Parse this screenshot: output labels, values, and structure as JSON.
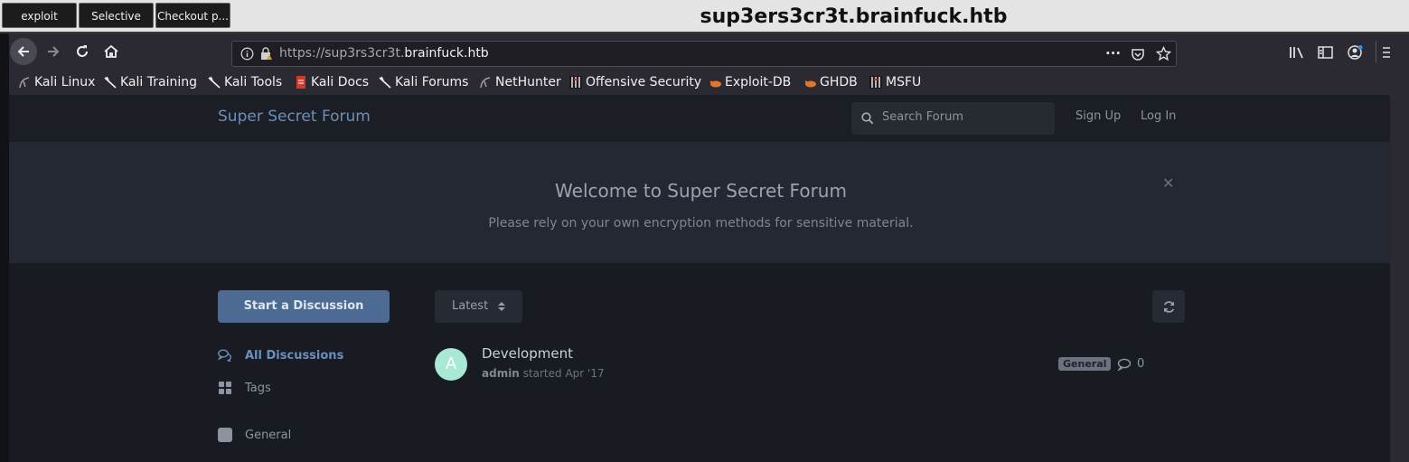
{
  "window": {
    "title": "sup3ers3cr3t.brainfuck.htb",
    "buttons": [
      "exploit",
      "Selective",
      "Checkout p..."
    ]
  },
  "browser": {
    "url_prefix": "https://sup3rs3cr3t.",
    "url_domain": "brainfuck.htb",
    "bookmarks": [
      "Kali Linux",
      "Kali Training",
      "Kali Tools",
      "Kali Docs",
      "Kali Forums",
      "NetHunter",
      "Offensive Security",
      "Exploit-DB",
      "GHDB",
      "MSFU"
    ]
  },
  "forum": {
    "brand": "Super Secret Forum",
    "search_placeholder": "Search Forum",
    "sign_up": "Sign Up",
    "log_in": "Log In",
    "welcome_title": "Welcome to Super Secret Forum",
    "welcome_text": "Please rely on your own encryption methods for sensitive material.",
    "start_button": "Start a Discussion",
    "sort_label": "Latest",
    "sidebar": {
      "all_discussions": "All Discussions",
      "tags": "Tags",
      "general": "General"
    },
    "discussion": {
      "avatar_letter": "A",
      "title": "Development",
      "author": "admin",
      "started": "started Apr '17",
      "tag": "General",
      "reply_count": "0"
    }
  },
  "colors": {
    "accent": "#4d6a92",
    "brand": "#6b8fbd",
    "avatar": "#a8e8d4"
  }
}
